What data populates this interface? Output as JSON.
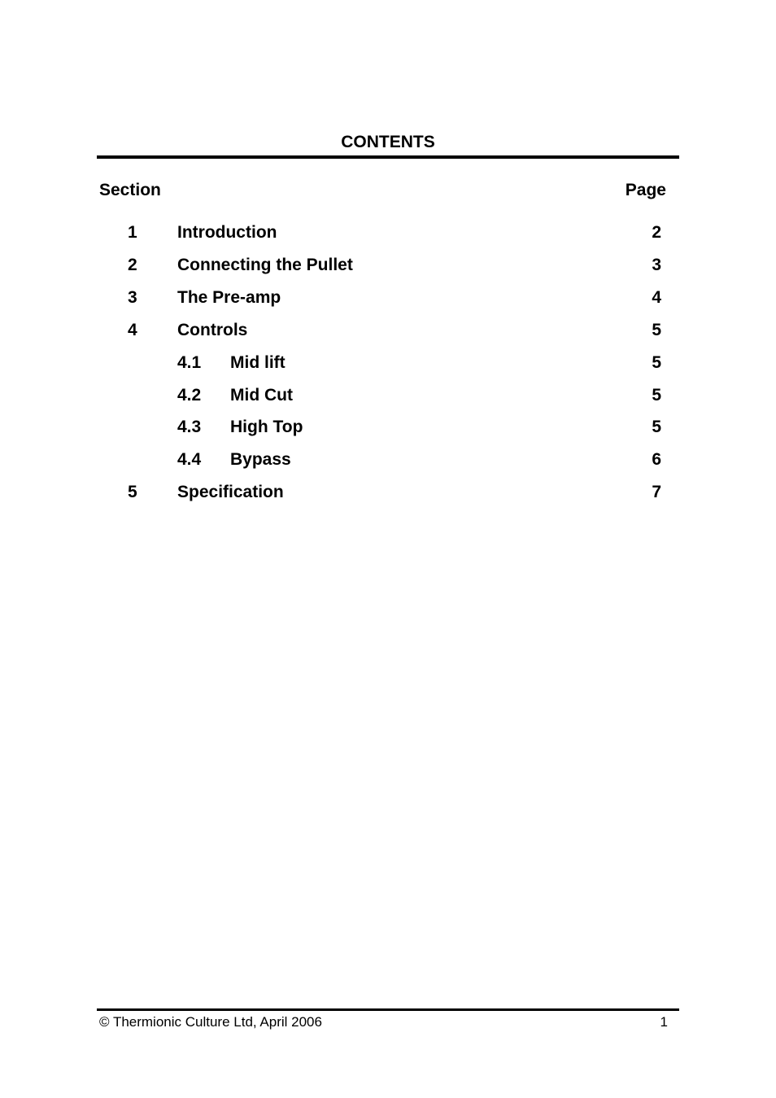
{
  "document": {
    "title": "CONTENTS",
    "header": {
      "section_label": "Section",
      "page_label": "Page"
    },
    "entries": [
      {
        "level": 1,
        "number": "1",
        "title": "Introduction",
        "page": "2"
      },
      {
        "level": 1,
        "number": "2",
        "title": "Connecting the Pullet",
        "page": "3"
      },
      {
        "level": 1,
        "number": "3",
        "title": "The Pre-amp",
        "page": "4"
      },
      {
        "level": 1,
        "number": "4",
        "title": "Controls",
        "page": "5"
      },
      {
        "level": 2,
        "number": "4.1",
        "title": "Mid lift",
        "page": "5"
      },
      {
        "level": 2,
        "number": "4.2",
        "title": "Mid Cut",
        "page": "5"
      },
      {
        "level": 2,
        "number": "4.3",
        "title": "High Top",
        "page": "5"
      },
      {
        "level": 2,
        "number": "4.4",
        "title": "Bypass",
        "page": "6"
      },
      {
        "level": 1,
        "number": "5",
        "title": "Specification",
        "page": "7"
      }
    ],
    "footer": {
      "copyright": "© Thermionic Culture Ltd, April 2006",
      "page_number": "1"
    }
  }
}
